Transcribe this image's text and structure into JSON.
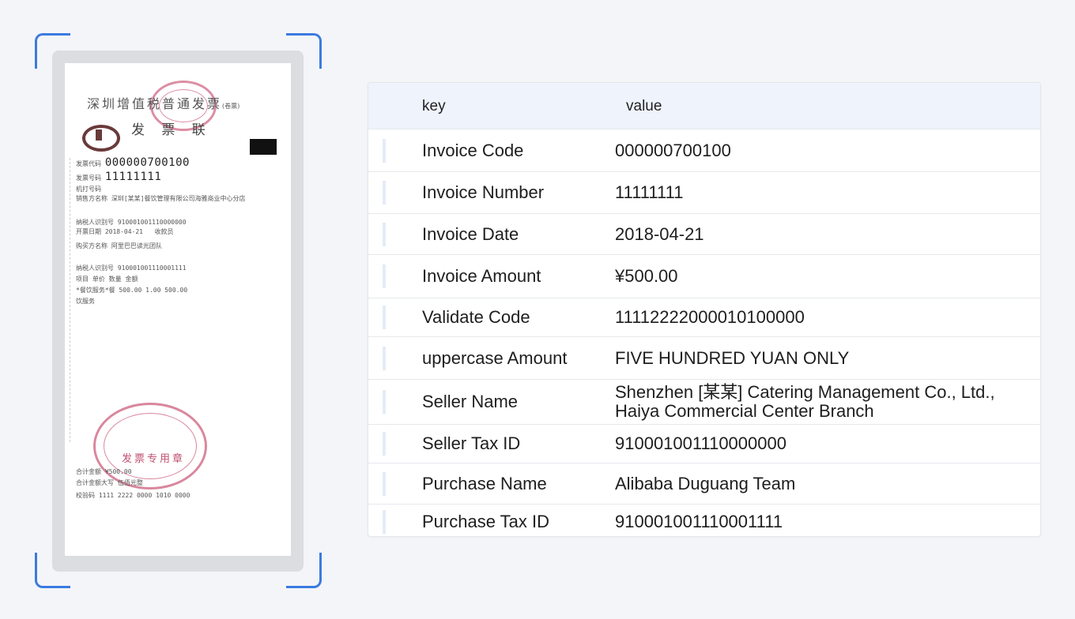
{
  "receipt": {
    "title": "深圳增值税普通发票",
    "title_note": "(卷票)",
    "subtitle": "发 票 联",
    "code_label": "发票代码",
    "code_value": "000000700100",
    "number_label": "发票号码",
    "number_value": "11111111",
    "machine_label": "机打号码",
    "seller_label": "销售方名称",
    "seller_value": "深圳[某某]餐饮管理有限公司海雅商业中心分店",
    "seller_tax_label": "纳税人识别号",
    "seller_tax_value": "910001001110000000",
    "date_label": "开票日期",
    "date_value": "2018-04-21",
    "cashier_label": "收款员",
    "buyer_label": "购买方名称",
    "buyer_value": "阿里巴巴读光团队",
    "buyer_tax_label": "纳税人识别号",
    "buyer_tax_value": "910001001110001111",
    "items_header": "项目  单价  数量  金额",
    "item_line": "*餐饮服务*餐 500.00  1.00  500.00",
    "item_sub": "饮服务",
    "stamp_text": "发票专用章",
    "total_label": "合计金额",
    "total_value": "¥500.00",
    "total_upper_label": "合计金额大写",
    "total_upper_value": "伍佰元整",
    "check_label": "校验码",
    "check_value": "1111 2222 0000 1010 0000"
  },
  "table": {
    "header_key": "key",
    "header_value": "value",
    "rows": [
      {
        "key": "Invoice Code",
        "value": "000000700100"
      },
      {
        "key": "Invoice Number",
        "value": "11111111"
      },
      {
        "key": "Invoice Date",
        "value": "2018-04-21"
      },
      {
        "key": "Invoice Amount",
        "value": "¥500.00"
      },
      {
        "key": "Validate Code",
        "value": "11112222000010100000"
      },
      {
        "key": "uppercase Amount",
        "value": "FIVE HUNDRED YUAN ONLY"
      },
      {
        "key": "Seller Name",
        "value": "Shenzhen [某某] Catering Management Co., Ltd., Haiya Commercial Center Branch"
      },
      {
        "key": "Seller Tax ID",
        "value": "910001001110000000"
      },
      {
        "key": "Purchase Name",
        "value": "Alibaba Duguang Team"
      },
      {
        "key": "Purchase Tax ID",
        "value": "910001001110001111"
      }
    ]
  },
  "colors": {
    "accent": "#3b7be0",
    "header_bg": "#eef3fc",
    "stamp": "#d06a86"
  }
}
